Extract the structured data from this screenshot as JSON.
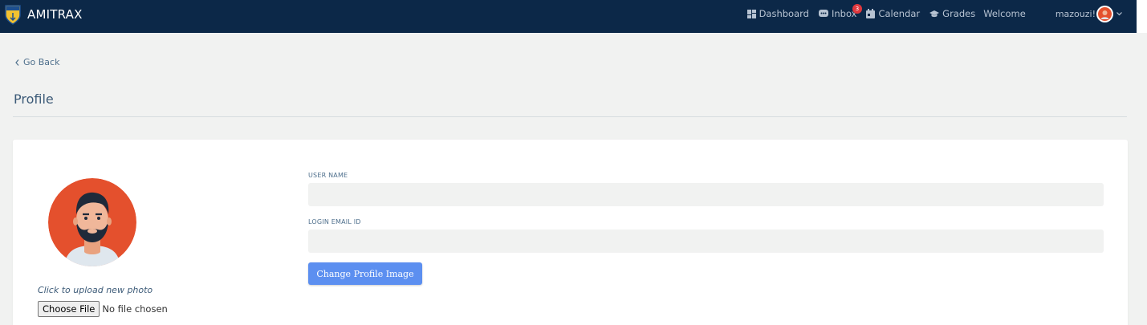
{
  "brand": {
    "name": "AMITRAX",
    "logo_icon": "shield-logo-icon"
  },
  "nav": {
    "dashboard": "Dashboard",
    "inbox": "Inbox",
    "inbox_badge": "3",
    "calendar": "Calendar",
    "grades": "Grades",
    "welcome": "Welcome",
    "username": "mazouzi!"
  },
  "page": {
    "go_back": "Go Back",
    "title": "Profile"
  },
  "profile": {
    "upload_hint": "Click to upload new photo",
    "file_button": "Choose File",
    "file_status": "No file chosen",
    "username_label": "USER NAME",
    "username_value": "",
    "email_label": "LOGIN EMAIL ID",
    "email_value": "",
    "change_button": "Change Profile Image"
  },
  "colors": {
    "topbar": "#0c2848",
    "accent_button": "#5c8ff0",
    "badge": "#e0383e",
    "avatar_bg": "#e4502d"
  }
}
